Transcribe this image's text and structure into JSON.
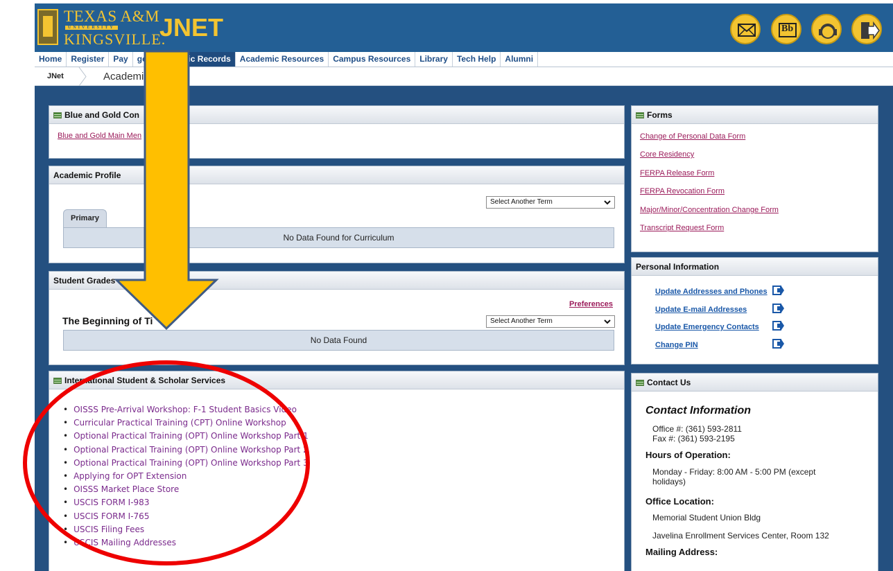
{
  "header": {
    "logo_line1": "TEXAS A&M",
    "logo_line2": "UNIVERSITY",
    "logo_line3": "KINGSVILLE.",
    "app_title": "JNET",
    "icons": [
      "mail-icon",
      "blackboard-icon",
      "support-headset-icon",
      "logout-icon"
    ],
    "blackboard_label": "Bb"
  },
  "nav": {
    "tabs": [
      {
        "label": "Home",
        "active": false
      },
      {
        "label": "Register",
        "active": false
      },
      {
        "label": "Pay",
        "active": false
      },
      {
        "label": "ge",
        "active": false
      },
      {
        "label": "Academic Records",
        "active": true
      },
      {
        "label": "Academic Resources",
        "active": false
      },
      {
        "label": "Campus Resources",
        "active": false
      },
      {
        "label": "Library",
        "active": false
      },
      {
        "label": "Tech Help",
        "active": false
      },
      {
        "label": "Alumni",
        "active": false
      }
    ]
  },
  "breadcrumb": {
    "home": "JNet",
    "current": "Academi"
  },
  "blue_gold": {
    "title": "Blue and Gold Con",
    "link": "Blue and Gold Main Men"
  },
  "academic_profile": {
    "title": "Academic Profile",
    "select_value": "Select Another Term",
    "tab_label": "Primary",
    "empty_message": "No Data Found for Curriculum"
  },
  "student_grades": {
    "title": "Student Grades",
    "preferences_link": "Preferences",
    "term_heading": "The Beginning of Ti",
    "select_value": "Select Another Term",
    "empty_message": "No Data Found"
  },
  "isss": {
    "title": "International Student & Scholar Services",
    "links": [
      "OISSS Pre-Arrival Workshop: F-1 Student Basics Video",
      "Curricular Practical Training (CPT) Online Workshop",
      "Optional Practical Training (OPT) Online Workshop Part 1",
      "Optional Practical Training (OPT) Online Workshop Part 2",
      "Optional Practical Training (OPT) Online Workshop Part 3",
      "Applying for OPT Extension",
      "OISSS Market Place Store",
      "USCIS FORM I-983",
      "USCIS FORM I-765",
      "USCIS Filing Fees",
      "USCIS Mailing Addresses"
    ]
  },
  "forms": {
    "title": "Forms",
    "links": [
      "Change of Personal Data Form",
      "Core Residency",
      "FERPA Release Form",
      "FERPA Revocation Form",
      "Major/Minor/Concentration Change Form",
      "Transcript Request Form"
    ]
  },
  "personal_info": {
    "title": "Personal Information",
    "links": [
      "Update Addresses and Phones",
      "Update E-mail Addresses",
      "Update Emergency Contacts",
      "Change PIN"
    ]
  },
  "contact": {
    "title": "Contact Us",
    "heading": "Contact Information",
    "office_line": "Office #:  (361) 593-2811",
    "fax_line": "Fax #:  (361) 593-2195",
    "hours_heading": "Hours of Operation:",
    "hours_line1": "Monday - Friday:  8:00 AM - 5:00 PM (except",
    "hours_line2": "holidays)",
    "location_heading": "Office Location:",
    "location_line1": "Memorial Student Union Bldg",
    "location_line2": "Javelina Enrollment Services Center, Room 132",
    "mailing_heading": "Mailing Address:"
  },
  "annotation": {
    "arrow_color": "#ffbf00",
    "arrow_outline": "#3f5b84",
    "circle_color": "#ee0000"
  }
}
